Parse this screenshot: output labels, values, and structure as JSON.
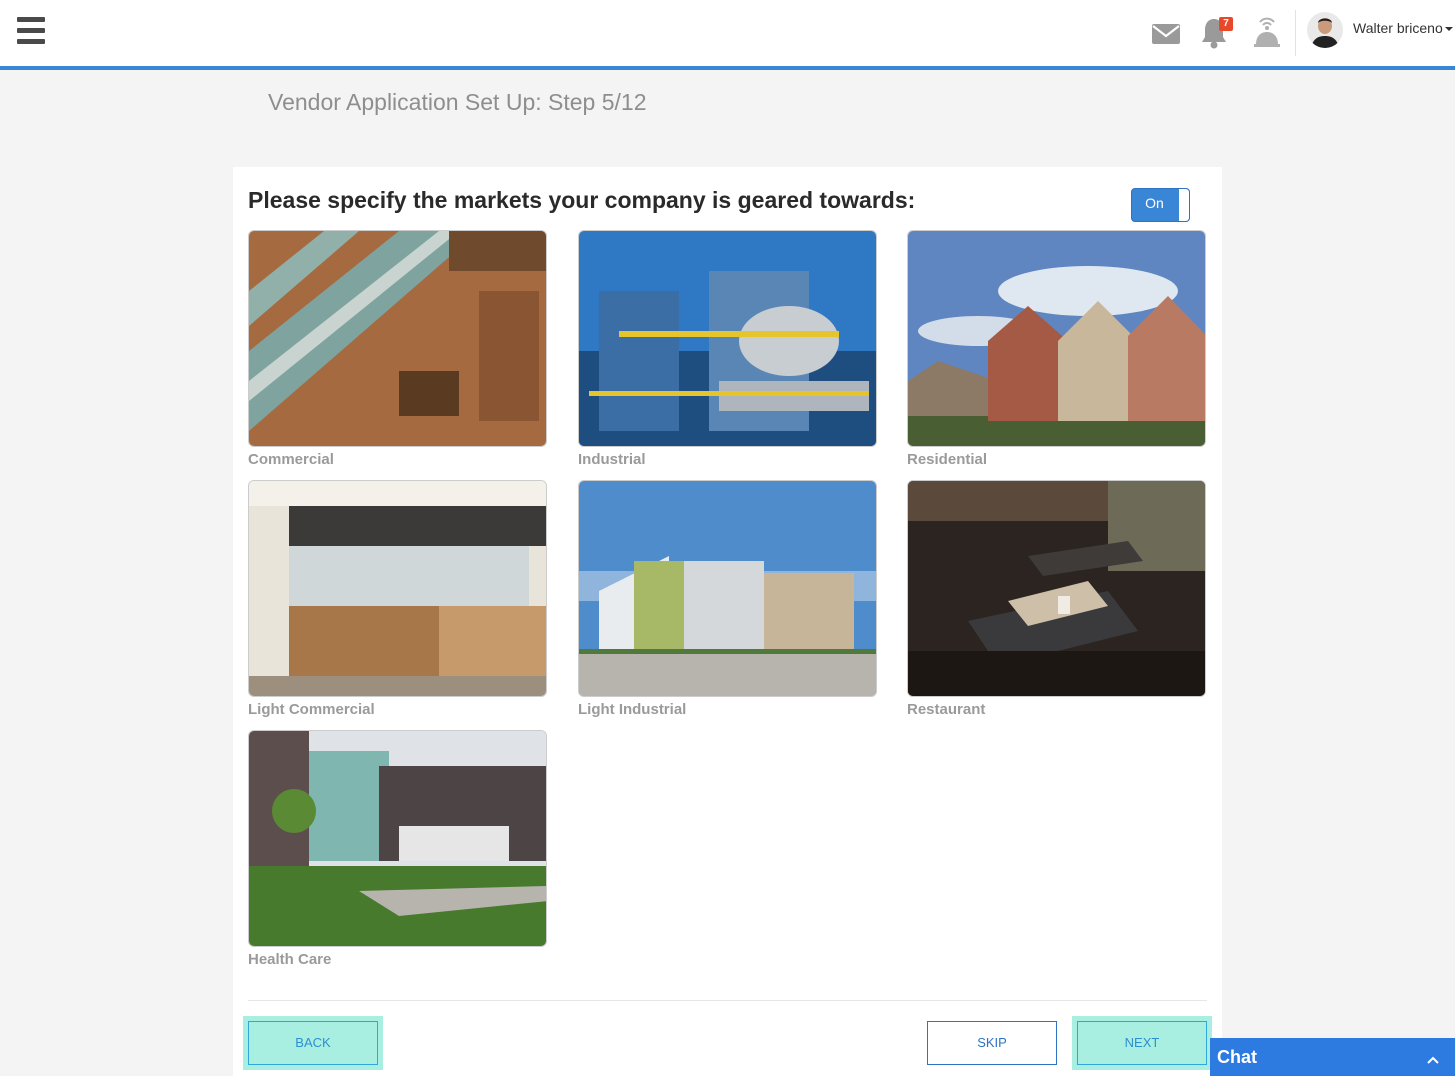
{
  "header": {
    "notification_count": "7",
    "user_name": "Walter briceno"
  },
  "page": {
    "heading": "Vendor Application Set Up: Step 5/12",
    "question": "Please specify the markets your company is geared towards:",
    "toggle_label": "On"
  },
  "markets": [
    {
      "label": "Commercial"
    },
    {
      "label": "Industrial"
    },
    {
      "label": "Residential"
    },
    {
      "label": "Light Commercial"
    },
    {
      "label": "Light Industrial"
    },
    {
      "label": "Restaurant"
    },
    {
      "label": "Health Care"
    }
  ],
  "buttons": {
    "back": "BACK",
    "skip": "SKIP",
    "next": "NEXT"
  },
  "chat": {
    "title": "Chat"
  },
  "colors": {
    "accent": "#3a86d6",
    "badge": "#e8492a",
    "highlight": "#a8efe1",
    "chat": "#2d7be0"
  }
}
